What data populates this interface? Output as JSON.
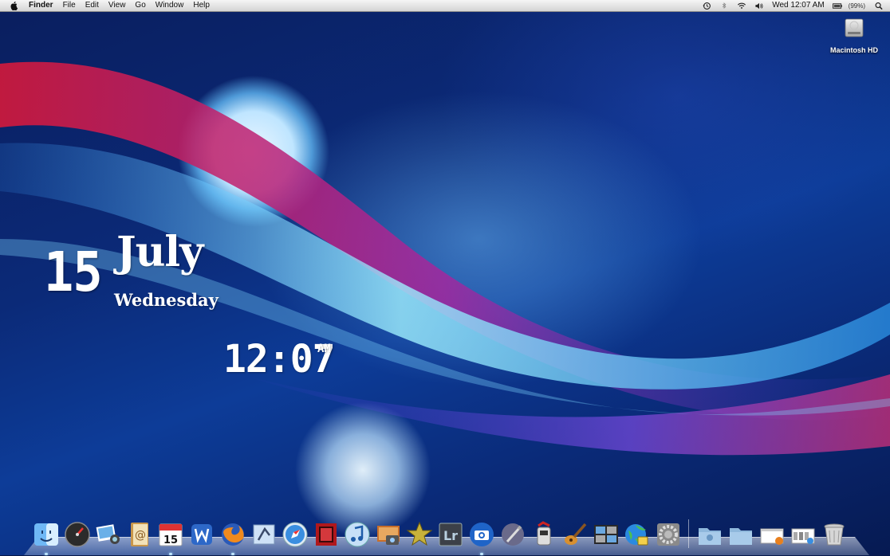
{
  "menubar": {
    "app": "Finder",
    "menus": [
      "File",
      "Edit",
      "View",
      "Go",
      "Window",
      "Help"
    ],
    "clock": "Wed 12:07 AM",
    "battery": "(99%)",
    "status_icons": [
      "time-machine-icon",
      "bluetooth-icon",
      "wifi-icon",
      "volume-icon",
      "battery-icon",
      "spotlight-icon"
    ]
  },
  "desktop": {
    "hd_label": "Macintosh HD"
  },
  "widget": {
    "day": "15",
    "month": "July",
    "weekday": "Wednesday",
    "time": "12:07",
    "ampm": "AM"
  },
  "calendar_icon_day": "15",
  "lightroom_label": "Lr",
  "colors": {
    "accent": "#1c5fd6",
    "menubar_top": "#f5f5f5",
    "menubar_bottom": "#d4d4d4"
  },
  "dock": {
    "apps": [
      "finder-icon",
      "dashboard-icon",
      "iphoto-icon",
      "address-book-icon",
      "ical-icon",
      "word-icon",
      "firefox-icon",
      "mail-icon",
      "safari-icon",
      "photo-booth-icon",
      "itunes-icon",
      "image-capture-icon",
      "imovie-icon",
      "lightroom-icon",
      "screenshot-icon",
      "script-editor-icon",
      "automator-icon",
      "garageband-icon",
      "spaces-icon",
      "network-icon",
      "system-preferences-icon"
    ],
    "stacks": [
      "downloads-stack-icon",
      "documents-stack-icon",
      "firefox-doc-stack-icon",
      "applications-stack-icon",
      "trash-icon"
    ]
  }
}
